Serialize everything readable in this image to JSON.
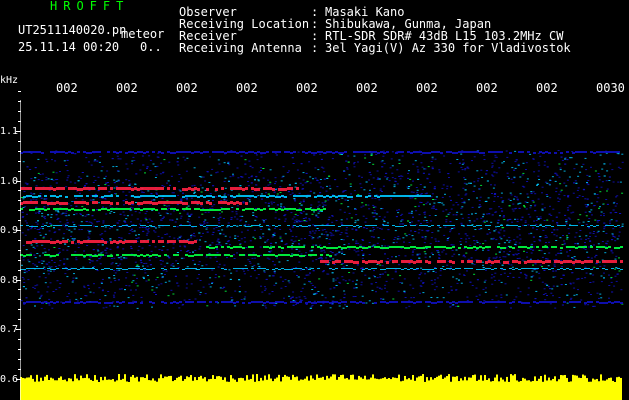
{
  "header": {
    "brand": "HROFFT",
    "file_name": "UT2511140020.pn",
    "file_suffix": "meteor",
    "datetime": "25.11.14 00:20",
    "datetime_extra": "0..",
    "info_rows": [
      {
        "label": "Observer",
        "value": "Masaki Kano"
      },
      {
        "label": "Receiving Location",
        "value": "Shibukawa, Gunma, Japan"
      },
      {
        "label": "Receiver",
        "value": "RTL-SDR SDR# 43dB L15 103.2MHz CW"
      },
      {
        "label": "Receiving Antenna",
        "value": "3el Yagi(V) Az 330 for Vladivostok"
      }
    ],
    "separator": ":"
  },
  "axis": {
    "y_unit": "kHz",
    "y_ticks": [
      "1.1",
      "1.0",
      "0.9",
      "0.8",
      "0.7",
      "0.6"
    ],
    "x_ticks": [
      "002",
      "002",
      "002",
      "002",
      "002",
      "002",
      "002",
      "002",
      "002",
      "0030"
    ]
  },
  "colors": {
    "background": "#000000",
    "weak": "#1010c0",
    "mid": "#00c8ff",
    "strong": "#00ff40",
    "peak": "#ff2040",
    "audio_bar": "#ffff00"
  }
}
